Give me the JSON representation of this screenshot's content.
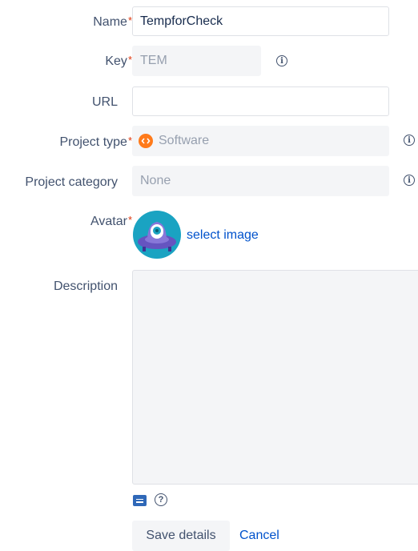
{
  "form": {
    "name": {
      "label": "Name",
      "required_mark": "*",
      "value": "TempforCheck"
    },
    "key": {
      "label": "Key",
      "required_mark": "*",
      "value": "TEM"
    },
    "url": {
      "label": "URL",
      "value": ""
    },
    "project_type": {
      "label": "Project type",
      "required_mark": "*",
      "value": "Software",
      "icon": "software-project-icon"
    },
    "project_category": {
      "label": "Project category",
      "value": "None"
    },
    "avatar": {
      "label": "Avatar",
      "required_mark": "*",
      "link": "select image"
    },
    "description": {
      "label": "Description",
      "value": ""
    }
  },
  "actions": {
    "save_label": "Save details",
    "cancel_label": "Cancel"
  },
  "colors": {
    "required": "#de350b",
    "link": "#0052cc",
    "software_icon": "#ff7a1a",
    "avatar_bg": "#1aa3c2"
  }
}
